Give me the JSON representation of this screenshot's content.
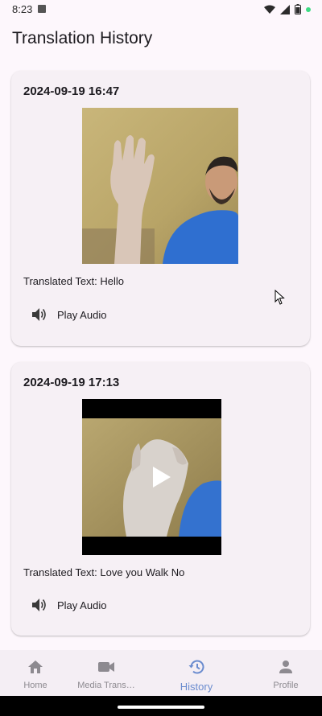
{
  "status_bar": {
    "time": "8:23"
  },
  "app_bar": {
    "title": "Translation History"
  },
  "history": [
    {
      "date": "2024-09-19 16:47",
      "translated_text": "Translated Text: Hello",
      "play_label": "Play Audio",
      "media": "image"
    },
    {
      "date": "2024-09-19 17:13",
      "translated_text": "Translated Text: Love you Walk No",
      "play_label": "Play Audio",
      "media": "video"
    }
  ],
  "nav": {
    "items": [
      {
        "label": "Home",
        "icon": "home-icon",
        "active": false
      },
      {
        "label": "Media Trans…",
        "icon": "videocam-icon",
        "active": false
      },
      {
        "label": "History",
        "icon": "history-icon",
        "active": true
      },
      {
        "label": "Profile",
        "icon": "person-icon",
        "active": false
      }
    ]
  },
  "colors": {
    "background": "#fdf7fc",
    "card": "#f6f0f5",
    "nav_active": "#6b8ccf",
    "nav_inactive": "#8d8a90"
  }
}
